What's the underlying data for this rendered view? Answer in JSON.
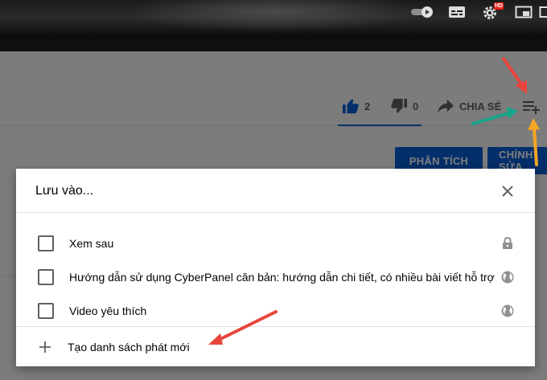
{
  "player": {
    "hd_badge": "HD"
  },
  "actions": {
    "like_count": "2",
    "dislike_count": "0",
    "share_label": "CHIA SẺ"
  },
  "buttons": {
    "analytics_label": "PHÂN TÍCH",
    "edit_label": "CHỈNH SỬA"
  },
  "dialog": {
    "title": "Lưu vào...",
    "playlists": [
      {
        "label": "Xem sau",
        "icon": "lock-icon",
        "checked": false
      },
      {
        "label": "Hướng dẫn sử dụng CyberPanel căn bản: hướng dẫn chi tiết, có nhiều bài viết hỗ trợ",
        "icon": "globe-icon",
        "checked": false
      },
      {
        "label": "Video yêu thích",
        "icon": "globe-icon",
        "checked": false
      }
    ],
    "create_label": "Tạo danh sách phát mới"
  },
  "colors": {
    "accent": "#065fd4",
    "arrow_red": "#e8453c",
    "arrow_green": "#17a589",
    "arrow_orange": "#f5a623"
  }
}
